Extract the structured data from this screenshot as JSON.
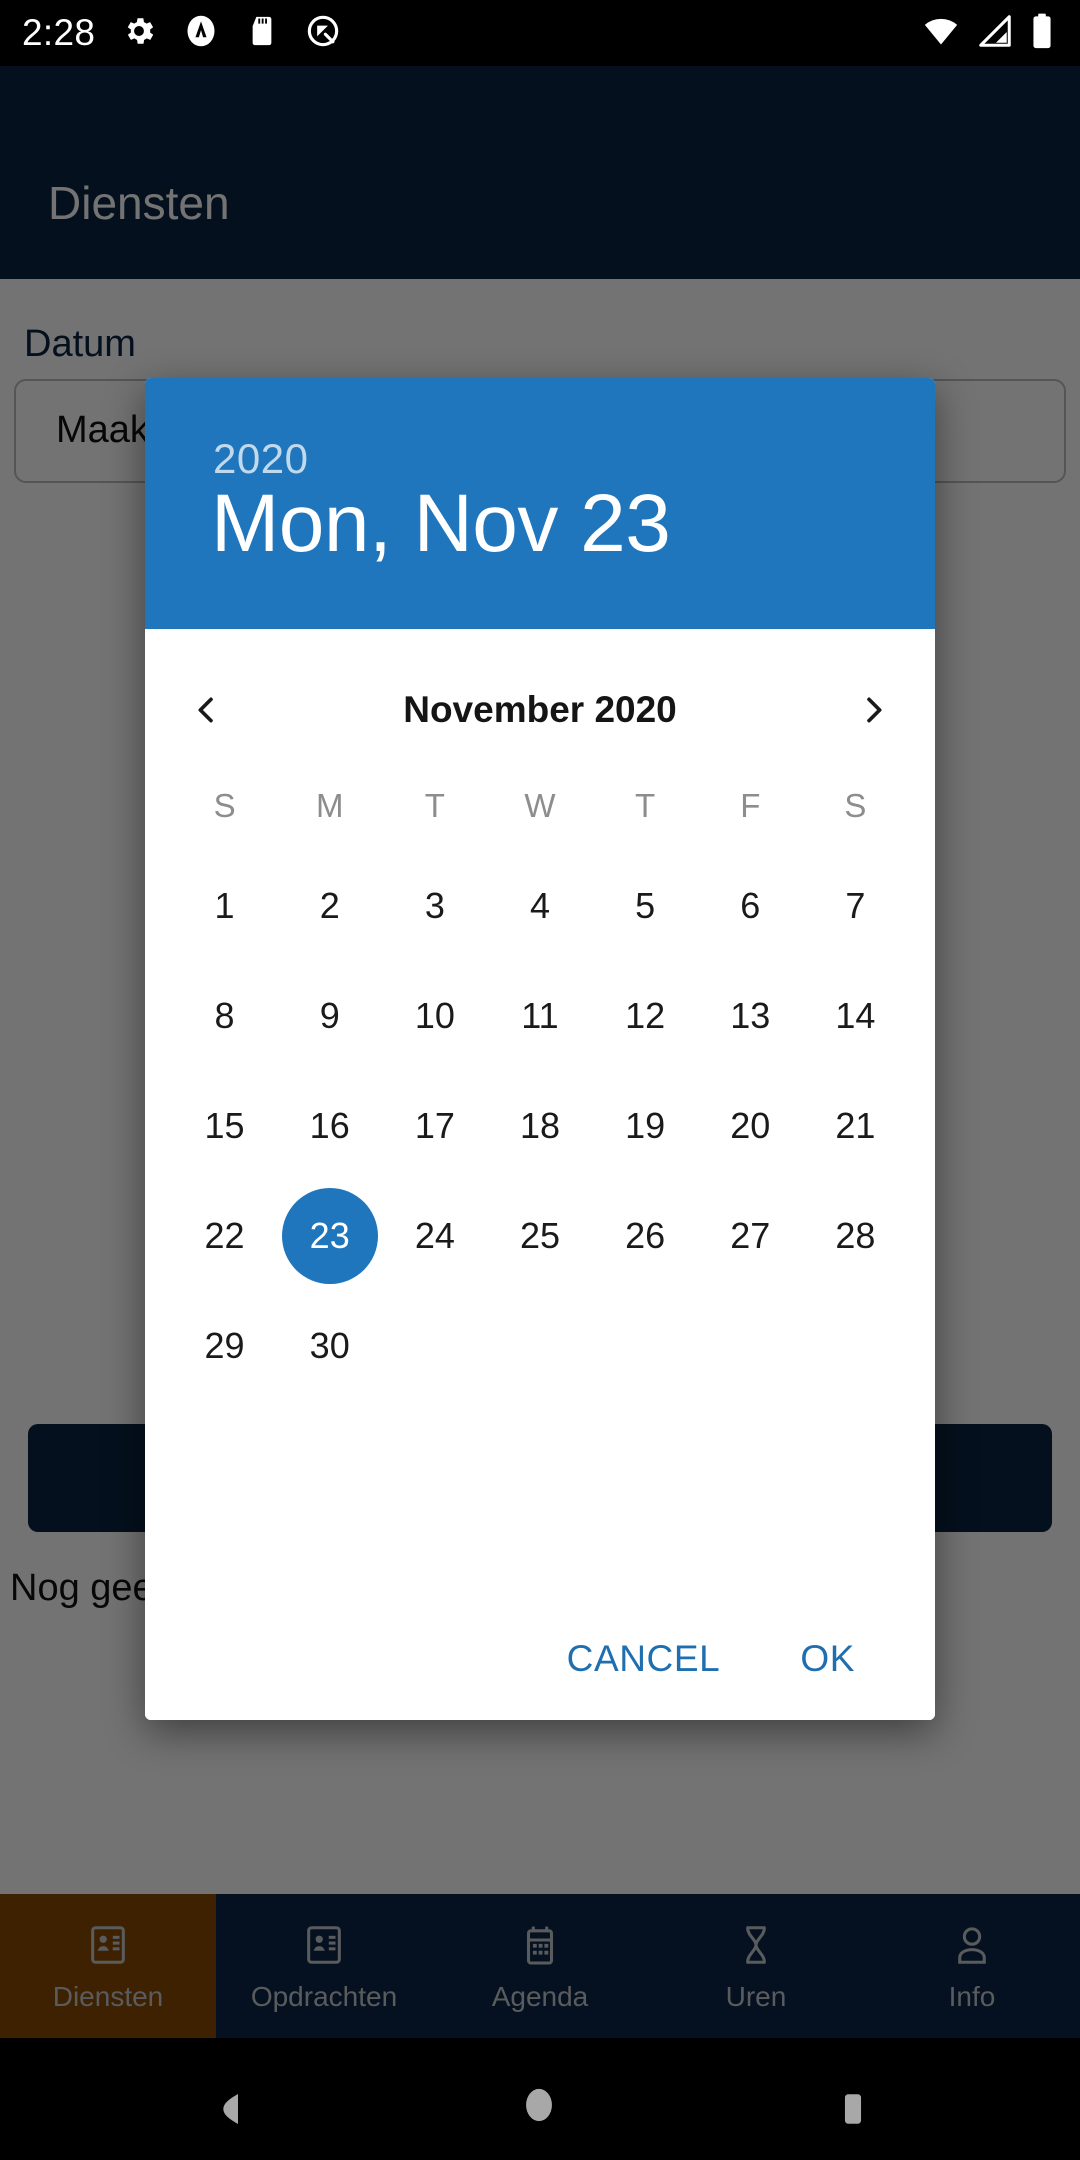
{
  "status_bar": {
    "time": "2:28",
    "left_icons": [
      "gear-icon",
      "android-studio-icon",
      "sd-card-icon",
      "android-q-icon"
    ],
    "right_icons": [
      "wifi-icon",
      "cell-signal-icon",
      "battery-icon"
    ]
  },
  "app": {
    "title": "Diensten",
    "appbar_color": "#0a2440",
    "form": {
      "datum_label": "Datum",
      "date_field_value": "Maak een keuze",
      "empty_text": "Nog geen diensten"
    },
    "bottom_nav": {
      "active_color": "#8b4a04",
      "items": [
        {
          "label": "Diensten",
          "icon": "contact-card-icon",
          "active": true
        },
        {
          "label": "Opdrachten",
          "icon": "contact-card-icon",
          "active": false
        },
        {
          "label": "Agenda",
          "icon": "calendar-icon",
          "active": false
        },
        {
          "label": "Uren",
          "icon": "hourglass-icon",
          "active": false
        },
        {
          "label": "Info",
          "icon": "person-icon",
          "active": false
        }
      ]
    }
  },
  "dialog": {
    "header": {
      "year": "2020",
      "date": "Mon, Nov 23",
      "color": "#1f76bd"
    },
    "month_title": "November 2020",
    "prev_label": "chevron-left-icon",
    "next_label": "chevron-right-icon",
    "weekdays": [
      "S",
      "M",
      "T",
      "W",
      "T",
      "F",
      "S"
    ],
    "leading_blanks": 0,
    "days": [
      1,
      2,
      3,
      4,
      5,
      6,
      7,
      8,
      9,
      10,
      11,
      12,
      13,
      14,
      15,
      16,
      17,
      18,
      19,
      20,
      21,
      22,
      23,
      24,
      25,
      26,
      27,
      28,
      29,
      30
    ],
    "selected_day": 23,
    "accent_color": "#1f76bd",
    "actions": {
      "cancel": "CANCEL",
      "ok": "OK"
    }
  },
  "nav_bar": {
    "back": "back-icon",
    "home": "home-icon",
    "recents": "recents-icon"
  }
}
